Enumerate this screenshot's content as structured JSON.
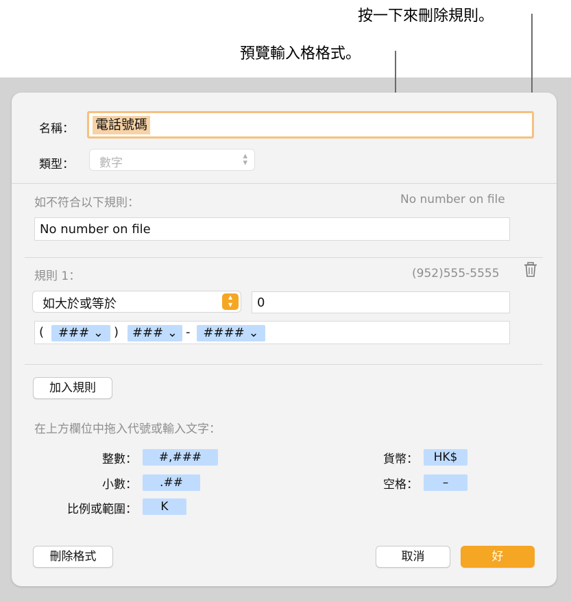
{
  "callouts": {
    "delete_rule": "按一下來刪除規則。",
    "preview_format": "預覽輸入格格式。"
  },
  "dialog": {
    "name_label": "名稱：",
    "name_value": "電話號碼",
    "type_label": "類型：",
    "type_value": "數字",
    "no_match_label": "如不符合以下規則：",
    "no_match_preview": "No number on file",
    "no_match_value": "No number on file",
    "rule1_label": "規則 1：",
    "rule1_preview": "(952)555-5555",
    "condition_value": "如大於或等於",
    "condition_number": "0",
    "format_tokens": {
      "open_paren": "(",
      "area": "### ⌄",
      "close_paren": ")",
      "prefix": "### ⌄",
      "dash": "-",
      "line": "#### ⌄"
    },
    "add_rule_button": "加入規則",
    "hint_text": "在上方欄位中拖入代號或輸入文字：",
    "tokens": {
      "integer_label": "整數：",
      "integer_value": "#,###",
      "decimal_label": "小數：",
      "decimal_value": ".##",
      "scale_label": "比例或範圍：",
      "scale_value": "K",
      "currency_label": "貨幣：",
      "currency_value": "HK$",
      "space_label": "空格：",
      "space_value": "–"
    },
    "delete_format_button": "刪除格式",
    "cancel_button": "取消",
    "ok_button": "好"
  },
  "colors": {
    "accent": "#f5a623",
    "token": "#bfdcff",
    "highlight": "#f6d2a6"
  },
  "icons": [
    "trash-icon",
    "chevron-updown-icon"
  ]
}
